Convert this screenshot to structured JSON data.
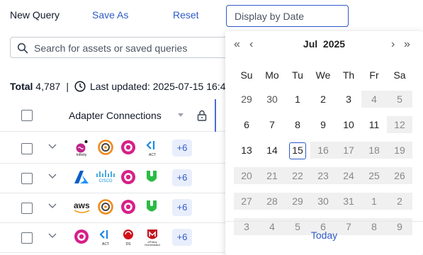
{
  "toolbar": {
    "new_query": "New Query",
    "save_as": "Save As",
    "reset": "Reset",
    "date_placeholder": "Display by Date"
  },
  "search": {
    "placeholder": "Search for assets or saved queries"
  },
  "summary": {
    "total_label": "Total",
    "total_value": "4,787",
    "updated_label": "Last updated:",
    "updated_value": "2025-07-15 16:4"
  },
  "table": {
    "column": "Adapter Connections",
    "rows": [
      {
        "icons": [
          "infinity",
          "cyberark",
          "cloudflare",
          "act"
        ],
        "icon_labels": [
          "Infinity",
          "",
          "",
          "ACT"
        ],
        "more": "+6"
      },
      {
        "icons": [
          "azure",
          "cisco",
          "cloudflare",
          "shield"
        ],
        "icon_labels": [
          "",
          "CISCO",
          "",
          ""
        ],
        "more": "+6"
      },
      {
        "icons": [
          "aws",
          "cyberark",
          "cloudflare",
          "shield"
        ],
        "icon_labels": [
          "aws",
          "",
          "",
          ""
        ],
        "more": "+6"
      },
      {
        "icons": [
          "cloudflare",
          "act",
          "ds",
          "epolicy"
        ],
        "icon_labels": [
          "",
          "ACT",
          "DS",
          "ePolicy Orchestrator"
        ],
        "more": "+6"
      }
    ]
  },
  "calendar": {
    "month": "Jul",
    "year": "2025",
    "weekdays": [
      "Su",
      "Mo",
      "Tu",
      "We",
      "Th",
      "Fr",
      "Sa"
    ],
    "weeks": [
      [
        "29",
        "30",
        "1",
        "2",
        "3",
        "4",
        "5"
      ],
      [
        "6",
        "7",
        "8",
        "9",
        "10",
        "11",
        "12"
      ],
      [
        "13",
        "14",
        "15",
        "16",
        "17",
        "18",
        "19"
      ],
      [
        "20",
        "21",
        "22",
        "23",
        "24",
        "25",
        "26"
      ],
      [
        "27",
        "28",
        "29",
        "30",
        "31",
        "1",
        "2"
      ],
      [
        "3",
        "4",
        "5",
        "6",
        "7",
        "8",
        "9"
      ]
    ],
    "selected_day": "15",
    "today_label": "Today"
  },
  "colors": {
    "accent": "#2e5ac8",
    "disabled_bg": "#f0f0f0"
  }
}
